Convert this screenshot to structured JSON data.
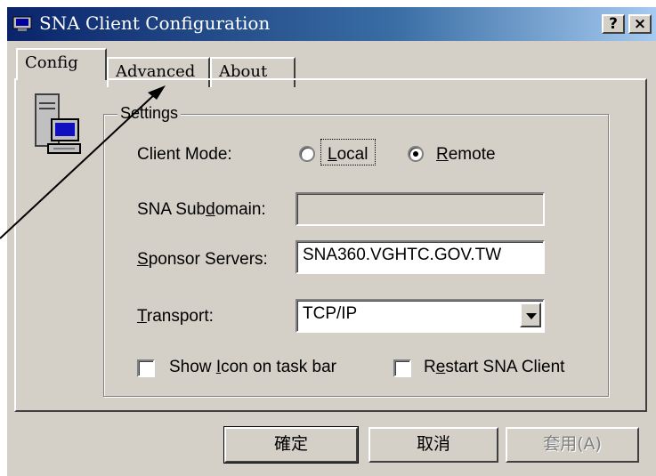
{
  "window": {
    "title": "SNA Client Configuration",
    "help_label": "?",
    "close_label": "×"
  },
  "tabs": [
    {
      "label": "Config",
      "active": true
    },
    {
      "label": "Advanced"
    },
    {
      "label": "About"
    }
  ],
  "settings": {
    "group_title": "Settings",
    "client_mode_label": "Client Mode:",
    "radio_local": {
      "pre": "",
      "key": "L",
      "post": "ocal",
      "selected": false
    },
    "radio_remote": {
      "pre": "",
      "key": "R",
      "post": "emote",
      "selected": true
    },
    "subdomain_label": {
      "pre": "SNA Sub",
      "key": "d",
      "post": "omain:"
    },
    "subdomain_value": "",
    "sponsor_label": {
      "pre": "",
      "key": "S",
      "post": "ponsor Servers:"
    },
    "sponsor_value": "SNA360.VGHTC.GOV.TW",
    "transport_label": {
      "pre": "",
      "key": "T",
      "post": "ransport:"
    },
    "transport_value": "TCP/IP",
    "show_icon_label": {
      "pre": "Show ",
      "key": "I",
      "post": "con on task bar",
      "checked": false
    },
    "restart_label": {
      "pre": "R",
      "key": "e",
      "post": "start SNA Client",
      "checked": false
    }
  },
  "buttons": {
    "ok": "確定",
    "cancel": "取消",
    "apply": "套用(A)"
  },
  "annotation": {
    "type": "arrow",
    "target": "Advanced tab"
  }
}
